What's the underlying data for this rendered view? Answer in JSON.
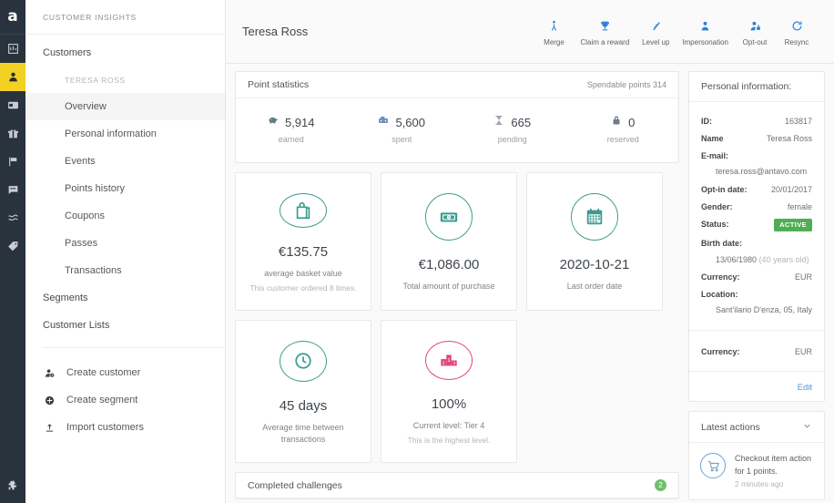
{
  "rail": {
    "logo": "a",
    "items": [
      {
        "name": "dashboard-icon",
        "label": "Dashboard",
        "active": false
      },
      {
        "name": "customers-icon",
        "label": "Customers",
        "active": true
      },
      {
        "name": "wallet-icon",
        "label": "Wallet",
        "active": false
      },
      {
        "name": "gift-icon",
        "label": "Rewards",
        "active": false
      },
      {
        "name": "flag-icon",
        "label": "Campaigns",
        "active": false
      },
      {
        "name": "message-icon",
        "label": "Messages",
        "active": false
      },
      {
        "name": "waves-icon",
        "label": "Flows",
        "active": false
      },
      {
        "name": "tag-icon",
        "label": "Tags",
        "active": false
      }
    ],
    "bottom": {
      "name": "puzzle-icon",
      "label": "Integrations"
    }
  },
  "nav": {
    "title": "CUSTOMER INSIGHTS",
    "root": "Customers",
    "customer_label": "TERESA ROSS",
    "sub_items": [
      {
        "label": "Overview",
        "selected": true
      },
      {
        "label": "Personal information",
        "selected": false
      },
      {
        "label": "Events",
        "selected": false
      },
      {
        "label": "Points history",
        "selected": false
      },
      {
        "label": "Coupons",
        "selected": false
      },
      {
        "label": "Passes",
        "selected": false
      },
      {
        "label": "Transactions",
        "selected": false
      }
    ],
    "groups": [
      {
        "label": "Segments"
      },
      {
        "label": "Customer Lists"
      }
    ],
    "actions": [
      {
        "label": "Create customer",
        "icon": "add-user-icon"
      },
      {
        "label": "Create segment",
        "icon": "plus-circle-icon"
      },
      {
        "label": "Import customers",
        "icon": "upload-icon"
      }
    ]
  },
  "header": {
    "customer_name": "Teresa Ross",
    "actions": [
      {
        "label": "Merge",
        "icon": "merge-person-icon"
      },
      {
        "label": "Claim a reward",
        "icon": "trophy-icon"
      },
      {
        "label": "Level up",
        "icon": "level-up-icon"
      },
      {
        "label": "Impersonation",
        "icon": "person-icon"
      },
      {
        "label": "Opt-out",
        "icon": "person-lock-icon"
      },
      {
        "label": "Resync",
        "icon": "refresh-icon"
      }
    ],
    "accent_color": "#2f80d8"
  },
  "point_statistics": {
    "title": "Point statistics",
    "spendable": "Spendable points 314",
    "stats": [
      {
        "value": "5,914",
        "label": "earned",
        "icon": "piggy-bank-icon"
      },
      {
        "value": "5,600",
        "label": "spent",
        "icon": "cash-register-icon"
      },
      {
        "value": "665",
        "label": "pending",
        "icon": "hourglass-icon"
      },
      {
        "value": "0",
        "label": "reserved",
        "icon": "lock-icon"
      }
    ]
  },
  "kpis": [
    {
      "icon": "shopping-bag-icon",
      "color": "#3d9c91",
      "value": "€135.75",
      "sub": "average basket value",
      "sub2": "This customer ordered 8 times."
    },
    {
      "icon": "money-icon",
      "color": "#3d9c91",
      "value": "€1,086.00",
      "sub": "Total amount of purchase",
      "sub2": ""
    },
    {
      "icon": "calendar-icon",
      "color": "#3d9c91",
      "value": "2020-10-21",
      "sub": "Last order date",
      "sub2": ""
    },
    {
      "icon": "clock-icon",
      "color": "#3d9c91",
      "value": "45 days",
      "sub": "Average time between transactions",
      "sub2": ""
    },
    {
      "icon": "podium-icon",
      "color": "#e0457b",
      "value": "100%",
      "sub": "Current level: Tier 4",
      "sub2": "This is the highest level."
    }
  ],
  "completed_challenges": {
    "title": "Completed challenges",
    "count": "2",
    "badge_color": "#71bf6b"
  },
  "personal_information": {
    "title": "Personal information:",
    "rows": [
      {
        "key": "ID:",
        "value": "163817",
        "type": "inline"
      },
      {
        "key": "Name",
        "value": "Teresa Ross",
        "type": "inline"
      },
      {
        "key": "E-mail:",
        "value": "teresa.ross@antavo.com",
        "type": "block"
      },
      {
        "key": "Opt-in date:",
        "value": "20/01/2017",
        "type": "inline"
      },
      {
        "key": "Gender:",
        "value": "female",
        "type": "inline"
      },
      {
        "key": "Status:",
        "value": "ACTIVE",
        "type": "badge"
      },
      {
        "key": "Birth date:",
        "value": "13/06/1980",
        "extra": "(40 years old)",
        "type": "block-extra"
      },
      {
        "key": "Currency:",
        "value": "EUR",
        "type": "inline"
      },
      {
        "key": "Location:",
        "value": "Sant'ilario D'enza, 05, Italy",
        "type": "block"
      }
    ],
    "currency_key": "Currency:",
    "currency_value": "EUR",
    "edit_label": "Edit",
    "status_color": "#4fae53"
  },
  "latest_actions": {
    "title": "Latest actions",
    "items": [
      {
        "icon": "cart-icon",
        "line1": "Checkout item action",
        "line2": "for 1 points.",
        "time": "2 minutes ago"
      }
    ]
  }
}
